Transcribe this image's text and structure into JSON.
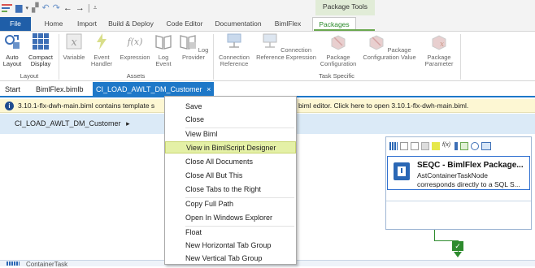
{
  "titlebar": {
    "context_group": "Package Tools"
  },
  "tabs": [
    "File",
    "Home",
    "Import",
    "Build & Deploy",
    "Code Editor",
    "Documentation",
    "BimlFlex",
    "Packages"
  ],
  "ribbon": {
    "layout": {
      "auto_layout": "Auto\nLayout",
      "compact_display": "Compact\nDisplay",
      "label": "Layout"
    },
    "assets": {
      "variable": "Variable",
      "event_handler": "Event\nHandler",
      "expression": "Expression",
      "log_event": "Log\nEvent",
      "log_provider": "Log\nProvider",
      "label": "Assets"
    },
    "task_specific": {
      "connection_reference": "Connection\nReference",
      "connection_reference_expression": "Connection\nReference Expression",
      "package_configuration": "Package\nConfiguration",
      "package_configuration_value": "Package\nConfiguration Value",
      "package_parameter": "Package\nParameter",
      "label": "Task Specific"
    }
  },
  "doc_tabs": {
    "start": "Start",
    "bimlflex": "BimlFlex.bimlb",
    "active": "CI_LOAD_AWLT_DM_Customer",
    "close_glyph": "×"
  },
  "infobar": {
    "text_left": "3.10.1-flx-dwh-main.biml contains template s",
    "text_right": "biml editor.  Click here to open 3.10.1-flx-dwh-main.biml."
  },
  "breadcrumb": {
    "item": "CI_LOAD_AWLT_DM_Customer",
    "arrow": "▸"
  },
  "node": {
    "title": "SEQC - BimlFlex Package...",
    "subtitle1": "AstContainerTaskNode",
    "subtitle2": "corresponds directly to a SQL S..."
  },
  "bottom_panel": {
    "label": "ContainerTask"
  },
  "context_menu": {
    "items": [
      "Save",
      "Close",
      "View Biml",
      "View in BimlScript Designer",
      "Close All Documents",
      "Close All But This",
      "Close Tabs to the Right",
      "Copy Full Path",
      "Open In Windows Explorer",
      "Float",
      "New Horizontal Tab Group",
      "New Vertical Tab Group"
    ],
    "highlighted_index": 3
  },
  "colors": {
    "file_tab": "#1f5ea8",
    "accent_blue": "#1e78c8",
    "context_green": "#6aa84f",
    "menu_highlight": "#e4f0a6",
    "infobar": "#fdf7d3",
    "breadcrumb_bg": "#dbeaf7"
  }
}
